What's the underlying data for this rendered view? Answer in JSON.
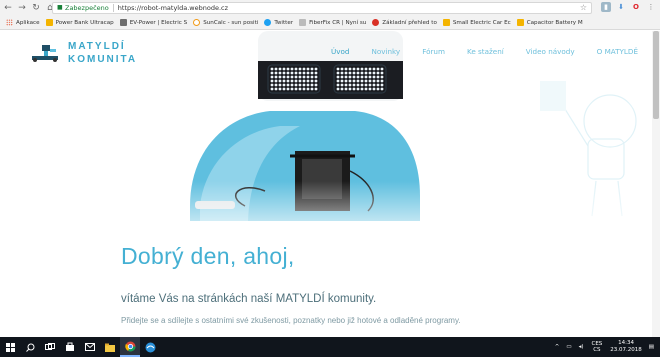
{
  "browser": {
    "secure_label": "Zabezpečeno",
    "url": "https://robot-matylda.webnode.cz",
    "bookmarks": [
      {
        "label": "Aplikace",
        "color": "#e34c26"
      },
      {
        "label": "Power Bank Ultracap",
        "color": "#f4b400"
      },
      {
        "label": "EV-Power | Electric S",
        "color": "#6d6d6d"
      },
      {
        "label": "SunCalc - sun positi",
        "color": "#f29b18"
      },
      {
        "label": "Twitter",
        "color": "#1da1f2"
      },
      {
        "label": "FiberFix CR | Nyní su",
        "color": "#999999"
      },
      {
        "label": "Základní přehled to",
        "color": "#d93025"
      },
      {
        "label": "Small Electric Car Ec",
        "color": "#f4b400"
      },
      {
        "label": "Capacitor Battery M",
        "color": "#f4b400"
      }
    ]
  },
  "site": {
    "logo_line1": "MATYLDÍ",
    "logo_line2": "KOMUNITA",
    "menu": [
      "Úvod",
      "Novinky",
      "Fórum",
      "Ke stažení",
      "Video návody",
      "O MATYLDĚ"
    ],
    "heading": "Dobrý den, ahoj,",
    "subheading": "vítáme Vás na stránkách naší MATYLDÍ komunity.",
    "intro": "Přidejte se a sdílejte s ostatními své zkušenosti, poznatky nebo již hotové a odladěné programy.",
    "accent_color": "#3aa6c9"
  },
  "taskbar": {
    "lang_top": "CES",
    "lang_bottom": "CS",
    "time": "14:34",
    "date": "23.07.2018"
  }
}
